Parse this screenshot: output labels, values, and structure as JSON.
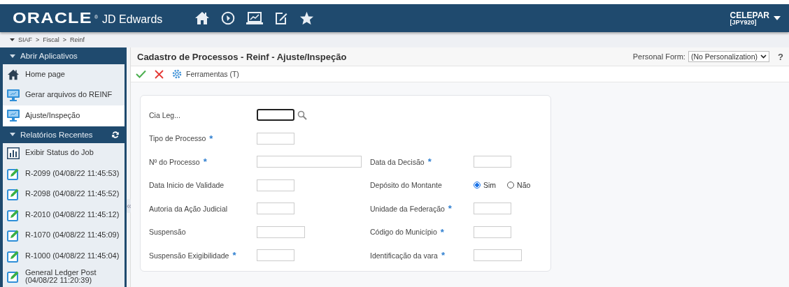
{
  "header": {
    "logo": "ORACLE",
    "logo_mark": "®",
    "product": "JD Edwards",
    "user": "CELEPAR",
    "environment": "[JPY920]"
  },
  "breadcrumb": [
    "SIAF",
    ">",
    "Fiscal",
    ">",
    "Reinf"
  ],
  "sidebar": {
    "sections": [
      {
        "title": "Abrir Aplicativos",
        "expanded": true,
        "refresh": false,
        "items": [
          {
            "label": "Home page",
            "kind": "home",
            "selected": false
          },
          {
            "label": "Gerar arquivos do REINF",
            "kind": "app",
            "selected": false
          },
          {
            "label": "Ajuste/Inspeção",
            "kind": "app",
            "selected": true
          }
        ]
      },
      {
        "title": "Relatórios Recentes",
        "expanded": true,
        "refresh": true,
        "items": [
          {
            "label": "Exibir Status do Job",
            "kind": "job",
            "selected": false
          },
          {
            "label": "R-2099 (04/08/22 11:45:53)",
            "kind": "report",
            "selected": false
          },
          {
            "label": "R-2098 (04/08/22 11:45:52)",
            "kind": "report",
            "selected": false
          },
          {
            "label": "R-2010 (04/08/22 11:45:12)",
            "kind": "report",
            "selected": false
          },
          {
            "label": "R-1070 (04/08/22 11:45:09)",
            "kind": "report",
            "selected": false
          },
          {
            "label": "R-1000 (04/08/22 11:45:04)",
            "kind": "report",
            "selected": false
          },
          {
            "label": "General Ledger Post (04/08/22 11:20:39)",
            "kind": "report",
            "selected": false
          }
        ]
      }
    ]
  },
  "collapse_handle": "«",
  "form_title": "Cadastro de Processos - Reinf - Ajuste/Inspeção",
  "personal_form": {
    "label": "Personal Form:",
    "value": "(No Personalization)",
    "help": "?"
  },
  "toolbar": [
    {
      "kind": "ok"
    },
    {
      "kind": "cancel"
    },
    {
      "kind": "tools",
      "label": "Ferramentas (T)"
    }
  ],
  "form": {
    "rows": [
      {
        "left": {
          "label": "Cia Leg...",
          "kind": "lookup",
          "focused": true
        }
      },
      {
        "left": {
          "label": "Tipo de Processo",
          "required_mark": "*",
          "kind": "short",
          "focused": false
        }
      },
      {
        "left": {
          "label": "Nº do Processo",
          "required_mark": "*",
          "kind": "long",
          "focused": false
        },
        "right": {
          "label": "Data da Decisão",
          "required_mark": "*",
          "kind": "short",
          "focused": false
        }
      },
      {
        "left": {
          "label": "Data Inicio de Validade",
          "kind": "short",
          "focused": false
        },
        "right": {
          "label": "Depósito do Montante",
          "kind": "radio",
          "options": [
            {
              "label": "Sim",
              "selected": true
            },
            {
              "label": "Não",
              "selected": false
            }
          ]
        }
      },
      {
        "left": {
          "label": "Autoria da Ação Judicial",
          "kind": "short",
          "focused": false
        },
        "right": {
          "label": "Unidade da Federação",
          "required_mark": "*",
          "kind": "short",
          "focused": false
        }
      },
      {
        "left": {
          "label": "Suspensão",
          "kind": "medium",
          "focused": false
        },
        "right": {
          "label": "Código do Município",
          "required_mark": "*",
          "kind": "short",
          "focused": false
        }
      },
      {
        "left": {
          "label": "Suspensão Exigibilidade",
          "required_mark": "*",
          "kind": "short",
          "focused": false
        },
        "right": {
          "label": "Identificação da vara",
          "required_mark": "*",
          "kind": "medium",
          "focused": false
        }
      }
    ]
  }
}
